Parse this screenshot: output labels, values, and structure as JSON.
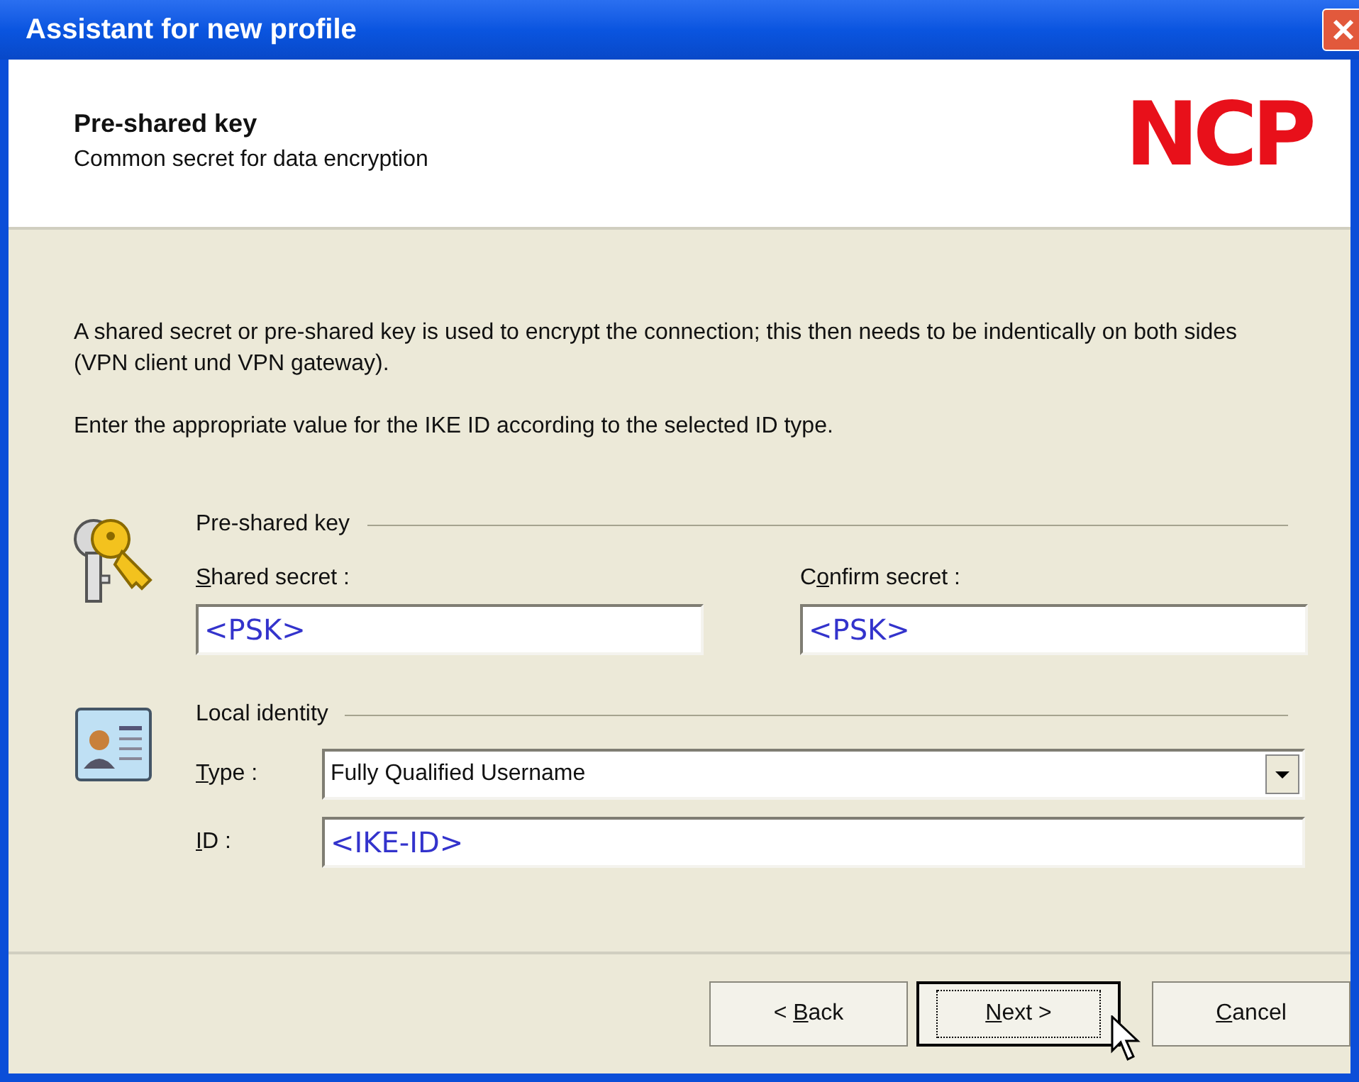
{
  "window": {
    "title": "Assistant for new profile"
  },
  "header": {
    "title": "Pre-shared key",
    "subtitle": "Common secret for data encryption",
    "logo": "NCP"
  },
  "paragraphs": [
    "A shared secret or pre-shared key is used to encrypt the connection; this then needs to be indentically on both sides (VPN client und VPN gateway).",
    "Enter the appropriate value for the IKE ID according to the selected ID type."
  ],
  "psk_group": {
    "title": "Pre-shared key",
    "fields": [
      {
        "access_key": "S",
        "label_after": "hared secret  :",
        "value": "<PSK>"
      },
      {
        "label_before": "C",
        "access_key": "o",
        "label_after": "nfirm secret :",
        "value": "<PSK>"
      }
    ]
  },
  "identity_group": {
    "title": "Local identity",
    "type": {
      "access_key": "T",
      "label_after": "ype :",
      "value": "Fully Qualified Username"
    },
    "id": {
      "access_key": "I",
      "label_after": "D :",
      "value": "<IKE-ID>"
    }
  },
  "buttons": [
    {
      "label_before": "< ",
      "access_key": "B",
      "label_after": "ack",
      "focused": false
    },
    {
      "access_key": "N",
      "label_after": "ext >",
      "focused": true
    },
    {
      "access_key": "C",
      "label_after": "ancel",
      "focused": false
    }
  ]
}
